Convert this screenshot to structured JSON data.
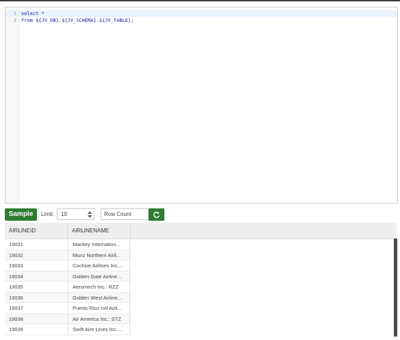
{
  "editor": {
    "lines": [
      {
        "num": "1",
        "text": "select *"
      },
      {
        "num": "2",
        "text": "from ${JV_DB}.${JV_SCHEMA}.${JV_TABLE};"
      }
    ]
  },
  "toolbar": {
    "sample_label": "Sample",
    "limit_label": "Limit:",
    "limit_value": "10",
    "rowcount_placeholder": "Row Count"
  },
  "table": {
    "columns": [
      "AIRLINEID",
      "AIRLINENAME"
    ],
    "rows": [
      [
        "19031",
        "Mackey Internation..."
      ],
      [
        "19032",
        "Munz Northern Airli..."
      ],
      [
        "19033",
        "Cochise Airlines Inc...."
      ],
      [
        "19034",
        "Golden Gate Airline..."
      ],
      [
        "19035",
        "Aeromech Inc.: RZZ"
      ],
      [
        "19036",
        "Golden West Airline..."
      ],
      [
        "19037",
        "Puerto Rico Intl Airli..."
      ],
      [
        "19038",
        "Air America Inc.: STZ"
      ],
      [
        "19039",
        "Swift Aire Lines Inc...."
      ]
    ]
  },
  "colors": {
    "accent": "#2e7d32",
    "code_text": "#1a1aa6",
    "header_bg": "#eeeeee"
  }
}
